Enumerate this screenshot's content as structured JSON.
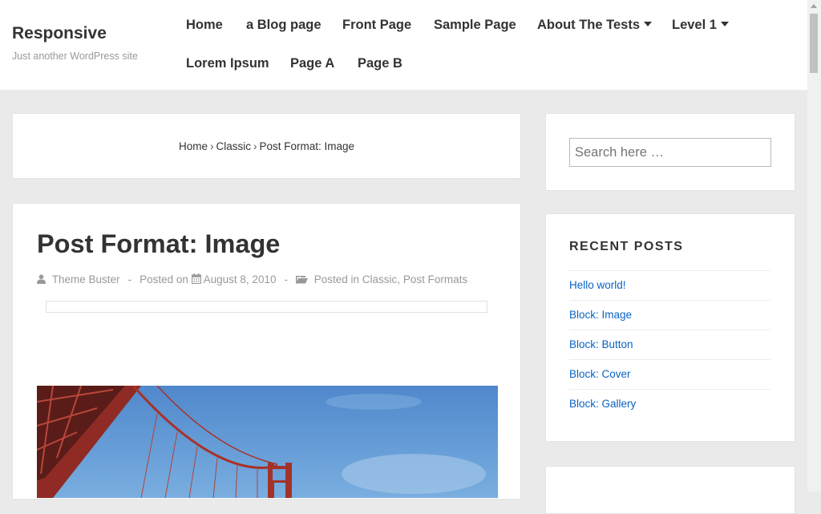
{
  "site": {
    "title": "Responsive",
    "description": "Just another WordPress site"
  },
  "nav": {
    "row1": [
      {
        "label": "Home",
        "has_dropdown": false
      },
      {
        "label": "a Blog page",
        "has_dropdown": false
      },
      {
        "label": "Front Page",
        "has_dropdown": false
      },
      {
        "label": "Sample Page",
        "has_dropdown": false
      },
      {
        "label": "About The Tests",
        "has_dropdown": true
      },
      {
        "label": "Level 1",
        "has_dropdown": true
      }
    ],
    "row2": [
      {
        "label": "Lorem Ipsum",
        "has_dropdown": false
      },
      {
        "label": "Page A",
        "has_dropdown": false
      },
      {
        "label": "Page B",
        "has_dropdown": false
      }
    ]
  },
  "breadcrumb": {
    "items": [
      "Home",
      "Classic",
      "Post Format: Image"
    ],
    "separator": "›"
  },
  "post": {
    "title": "Post Format: Image",
    "author": "Theme Buster",
    "posted_on_label": "Posted on",
    "date": "August 8, 2010",
    "posted_in_label": "Posted in",
    "categories": [
      "Classic",
      "Post Formats"
    ],
    "category_separator": ","
  },
  "sidebar": {
    "search": {
      "placeholder": "Search here …"
    },
    "recent_posts": {
      "title": "RECENT POSTS",
      "items": [
        "Hello world!",
        "Block: Image",
        "Block: Button",
        "Block: Cover",
        "Block: Gallery"
      ]
    }
  },
  "colors": {
    "link": "#0a63c4",
    "background": "#eaeaea",
    "text": "#333333",
    "muted": "#999999"
  },
  "icons": {
    "author": "user-icon",
    "date": "calendar-icon",
    "category": "folder-icon",
    "dropdown": "caret-down-icon"
  }
}
